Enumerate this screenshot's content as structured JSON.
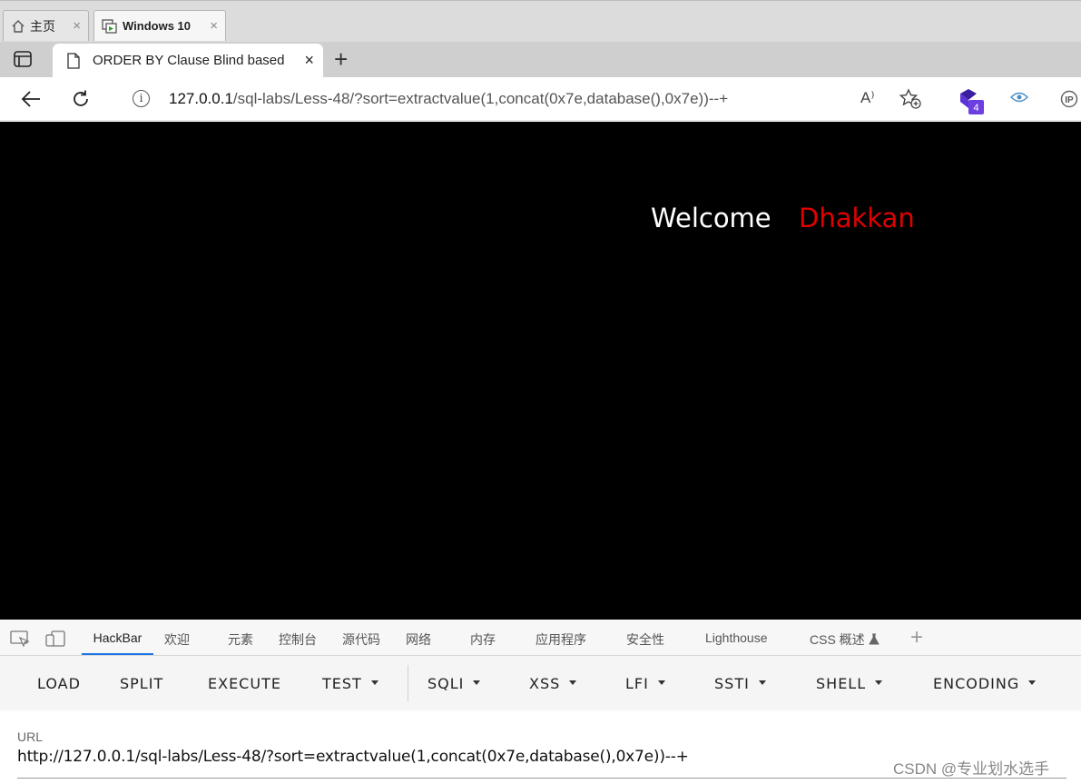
{
  "vm_tabs": [
    {
      "label": "主页",
      "close": "×"
    },
    {
      "label": "Windows 10",
      "close": "×"
    }
  ],
  "browser": {
    "tab_title": "ORDER BY Clause Blind based",
    "tab_close": "×",
    "new_tab": "+",
    "url_host": "127.0.0.1",
    "url_path": "/sql-labs/Less-48/?sort=extractvalue(1,concat(0x7e,database(),0x7e))--+",
    "read_aloud": "A⁾",
    "extension_badge": "4",
    "extension_ip": "IP"
  },
  "page": {
    "welcome": "Welcome",
    "name": "Dhakkan"
  },
  "devtools_tabs": [
    "HackBar",
    "欢迎",
    "元素",
    "控制台",
    "源代码",
    "网络",
    "内存",
    "应用程序",
    "安全性",
    "Lighthouse",
    "CSS 概述"
  ],
  "devtools_more": "+",
  "hackbar": {
    "buttons": [
      "LOAD",
      "SPLIT",
      "EXECUTE",
      "TEST",
      "SQLI",
      "XSS",
      "LFI",
      "SSTI",
      "SHELL",
      "ENCODING"
    ],
    "url_label": "URL",
    "url_value": "http://127.0.0.1/sql-labs/Less-48/?sort=extractvalue(1,concat(0x7e,database(),0x7e))--+"
  },
  "watermark": "CSDN @专业划水选手",
  "colors": {
    "page_bg": "#000000",
    "welcome": "#ffffff",
    "name": "#e00000",
    "accent": "#1a73e8"
  }
}
